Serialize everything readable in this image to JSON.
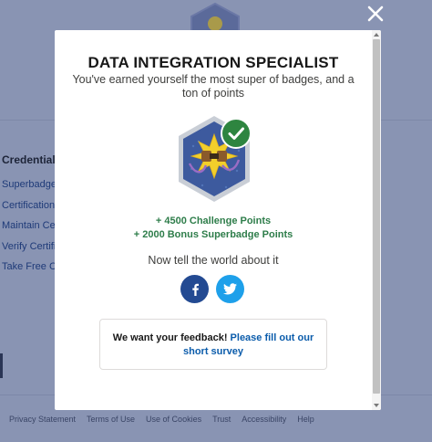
{
  "background": {
    "sidebar_title": "Credential",
    "sidebar_items": [
      "Superbadge",
      "Certification",
      "Maintain Ce",
      "Verify Certifi",
      "Take Free Ce"
    ],
    "footer_links": [
      "Privacy Statement",
      "Terms of Use",
      "Use of Cookies",
      "Trust",
      "Accessibility",
      "Help"
    ]
  },
  "modal": {
    "title": "DATA INTEGRATION SPECIALIST",
    "subtitle": "You've earned yourself the most super of badges, and a ton of points",
    "challenge_points": "+ 4500 Challenge Points",
    "bonus_points": "+ 2000 Bonus Superbadge Points",
    "share_prompt": "Now tell the world about it",
    "feedback_prefix": "We want your feedback!",
    "feedback_link": "Please fill out our short survey"
  },
  "colors": {
    "overlay_bg": "#8994b3",
    "points_green": "#2e7d4a",
    "link_blue": "#0b5cab",
    "facebook": "#234a92",
    "twitter": "#1ea0ea",
    "check_green": "#2e8540"
  },
  "icons": {
    "close": "close-icon",
    "facebook": "facebook-icon",
    "twitter": "twitter-icon",
    "badge": "superbadge-icon",
    "check": "checkmark-icon"
  }
}
